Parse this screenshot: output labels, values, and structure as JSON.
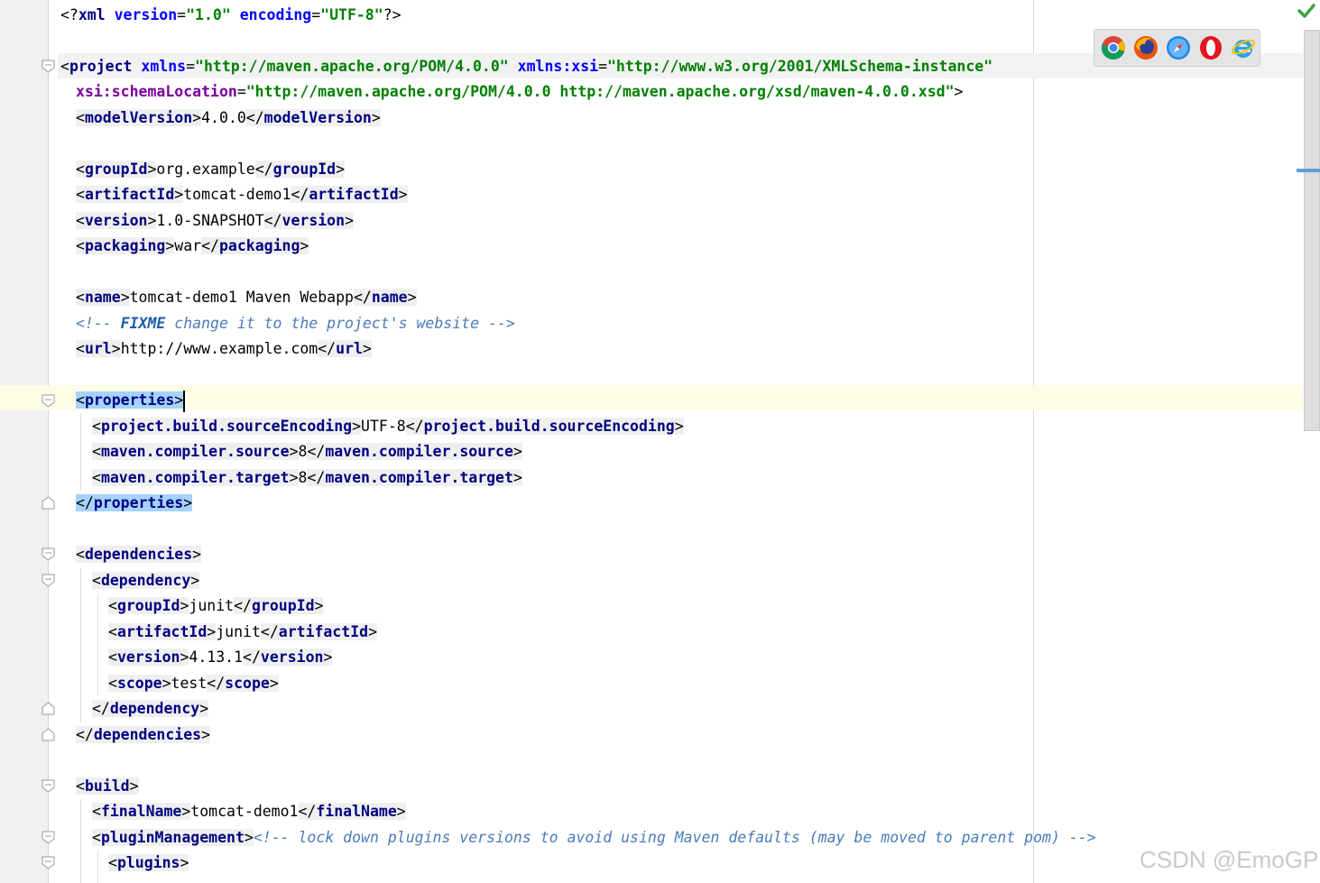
{
  "editor": {
    "file": {
      "xml_decl": {
        "open": "<?",
        "name": "xml",
        "attr1": "version",
        "val1": "\"1.0\"",
        "attr2": "encoding",
        "val2": "\"UTF-8\"",
        "close": "?>"
      },
      "project": {
        "tag": "project",
        "xmlns_attr": "xmlns",
        "xmlns_val": "\"http://maven.apache.org/POM/4.0.0\"",
        "xsi_attr": "xmlns:xsi",
        "xsi_val": "\"http://www.w3.org/2001/XMLSchema-instance\"",
        "schema_attr": "xsi:schemaLocation",
        "schema_val": "\"http://maven.apache.org/POM/4.0.0 http://maven.apache.org/xsd/maven-4.0.0.xsd\""
      },
      "model_version": {
        "tag": "modelVersion",
        "value": "4.0.0"
      },
      "group_id": {
        "tag": "groupId",
        "value": "org.example"
      },
      "artifact_id": {
        "tag": "artifactId",
        "value": "tomcat-demo1"
      },
      "version": {
        "tag": "version",
        "value": "1.0-SNAPSHOT"
      },
      "packaging": {
        "tag": "packaging",
        "value": "war"
      },
      "name": {
        "tag": "name",
        "value": "tomcat-demo1 Maven Webapp"
      },
      "comment_fixme": {
        "open": "<!-- ",
        "keyword": "FIXME",
        "text": " change it to the project's website ",
        "close": "-->"
      },
      "url": {
        "tag": "url",
        "value": "http://www.example.com"
      },
      "properties": {
        "tag": "properties",
        "items": [
          {
            "tag": "project.build.sourceEncoding",
            "value": "UTF-8"
          },
          {
            "tag": "maven.compiler.source",
            "value": "8"
          },
          {
            "tag": "maven.compiler.target",
            "value": "8"
          }
        ]
      },
      "dependencies": {
        "tag": "dependencies",
        "dependency_tag": "dependency",
        "items": [
          {
            "tag": "groupId",
            "value": "junit"
          },
          {
            "tag": "artifactId",
            "value": "junit"
          },
          {
            "tag": "version",
            "value": "4.13.1"
          },
          {
            "tag": "scope",
            "value": "test"
          }
        ]
      },
      "build": {
        "tag": "build",
        "final_name": {
          "tag": "finalName",
          "value": "tomcat-demo1"
        },
        "plugin_management_tag": "pluginManagement",
        "plugin_management_comment": "<!-- lock down plugins versions to avoid using Maven defaults (may be moved to parent pom) -->",
        "plugins_tag": "plugins"
      }
    }
  },
  "browser_bar": {
    "icons": [
      "chrome-icon",
      "firefox-icon",
      "safari-icon",
      "opera-icon",
      "internet-explorer-icon"
    ]
  },
  "status": {
    "inspection_icon": "checkmark-icon"
  },
  "watermark": "CSDN @EmoGP",
  "colors": {
    "tag": "#000080",
    "attribute": "#0000ff",
    "string": "#008000",
    "comment": "#4a7bb7",
    "selection": "#a6d2ff",
    "caret_line": "#fefbe6"
  }
}
